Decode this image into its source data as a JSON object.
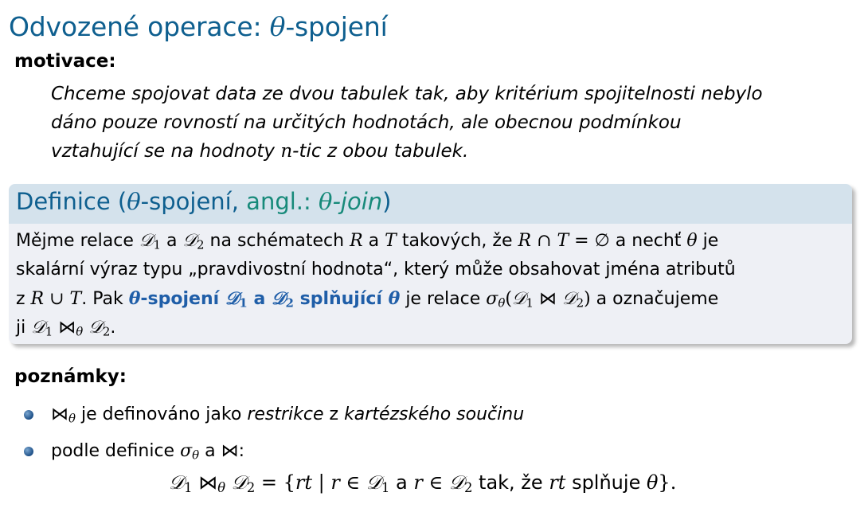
{
  "title": {
    "main": "Odvozené operace: ",
    "theta": "θ",
    "rest": "-spojení"
  },
  "motivation": {
    "heading": "motivace:",
    "lines": [
      "Chceme spojovat data ze dvou tabulek tak, aby kritérium spojitelnosti nebylo",
      "dáno pouze rovností na určitých hodnotách, ale obecnou podmínkou",
      "vztahující se na hodnoty "
    ],
    "n": "n",
    "line3_end": "-tic z obou tabulek."
  },
  "definition": {
    "title_word": "Definice (",
    "theta": "θ",
    "title_mid": "-spojení, ",
    "angl": "angl.: ",
    "join_theta": "θ",
    "join_word": "-join",
    "close": ")",
    "l1_a": "Mějme relace ",
    "D": "𝒟",
    "one": "1",
    "two": "2",
    "a": " a ",
    "l1_b": " na schématech ",
    "R": "R",
    "T": "T",
    "l1_c": " takových, že ",
    "cap": " ∩ ",
    "eq_empty": " = ∅",
    "l1_d": " a nechť ",
    "l1_e": " je",
    "l2": "skalární výraz typu „pravdivostní hodnota“, který může obsahovat jména atributů",
    "l3_z": "z ",
    "cup": " ∪ ",
    "l3_pak": ". Pak ",
    "bold_spojeni": "-spojení ",
    "bold_a": " a ",
    "bold_spl": " splňující ",
    "l3_relace": " je relace ",
    "sigma": "σ",
    "bowtie": "⋈",
    "l3_end": " a označujeme",
    "l4_ji": "ji ",
    "l4_end": "."
  },
  "notes": {
    "heading": "poznámky:",
    "item1_pre": " je definováno jako ",
    "restrikce": "restrikce",
    "z": " z ",
    "kartez": "kartézského součinu",
    "item2_pre": "podle definice ",
    "item2_a": " a ",
    "item2_colon": ":"
  },
  "formula": {
    "eq": " = {",
    "rt": "rt",
    "bar": " | ",
    "r": "r",
    "in": " ∈ ",
    "a": " a ",
    "tak": " tak, že ",
    "spl": " splňuje ",
    "end": "}."
  }
}
